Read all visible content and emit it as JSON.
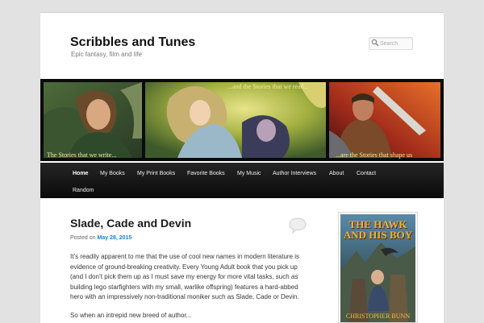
{
  "site": {
    "title": "Scribbles and Tunes",
    "description": "Epic fantasy, film and life"
  },
  "search": {
    "placeholder": "Search"
  },
  "banner": {
    "caption_left": "The Stories that we write...",
    "caption_middle": "...and the Stories that we read...",
    "caption_right": "...are the Stories that shape us"
  },
  "nav": {
    "items": [
      {
        "label": "Home",
        "active": true
      },
      {
        "label": "My Books"
      },
      {
        "label": "My Print Books"
      },
      {
        "label": "Favorite Books"
      },
      {
        "label": "My Music"
      },
      {
        "label": "Author Interviews"
      },
      {
        "label": "About"
      },
      {
        "label": "Contact"
      },
      {
        "label": "Random"
      }
    ]
  },
  "post": {
    "title": "Slade, Cade and Devin",
    "posted_prefix": "Posted on",
    "date": "May 28, 2015",
    "paragraphs": [
      "It’s readily apparent to me that the use of cool new names in modern literature is evidence of ground-breaking creativity. Every Young Adult book that you pick up (and I don’t pick them up as I must save my energy for more vital tasks, such as building lego starfighters with my small, warlike offspring) features a hard-abbed hero with an impressively non-traditional moniker such as Slade, Cade or Devin.",
      "So when an intrepid new breed of author..."
    ]
  },
  "sidebar": {
    "book": {
      "title_line1": "THE HAWK",
      "title_line2": "AND HIS BOY",
      "author": "CHRISTOPHER BUNN"
    }
  },
  "colors": {
    "link": "#1982d1",
    "nav_bg": "#111111",
    "banner_caption": "#f2e79a"
  }
}
